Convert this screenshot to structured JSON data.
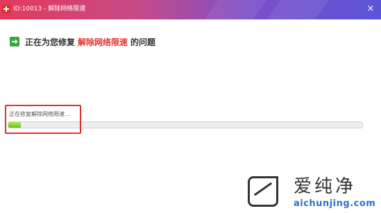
{
  "window": {
    "title": "ID:10013 - 解除网络限速",
    "close_glyph": "×"
  },
  "heading": {
    "prefix": "正在为您修复",
    "highlight": "解除网络限速",
    "suffix": "的问题",
    "highlight_color": "#e8322f",
    "icon": "green-arrow-right-icon"
  },
  "progress": {
    "status_label": "正在修复解除网络限速...",
    "value_percent": 3.5,
    "fill_color": "#63c223"
  },
  "annotation": {
    "box_color": "#e0302c"
  },
  "watermark": {
    "brand_cn": "爱纯净",
    "url": "aichunjing.com"
  }
}
